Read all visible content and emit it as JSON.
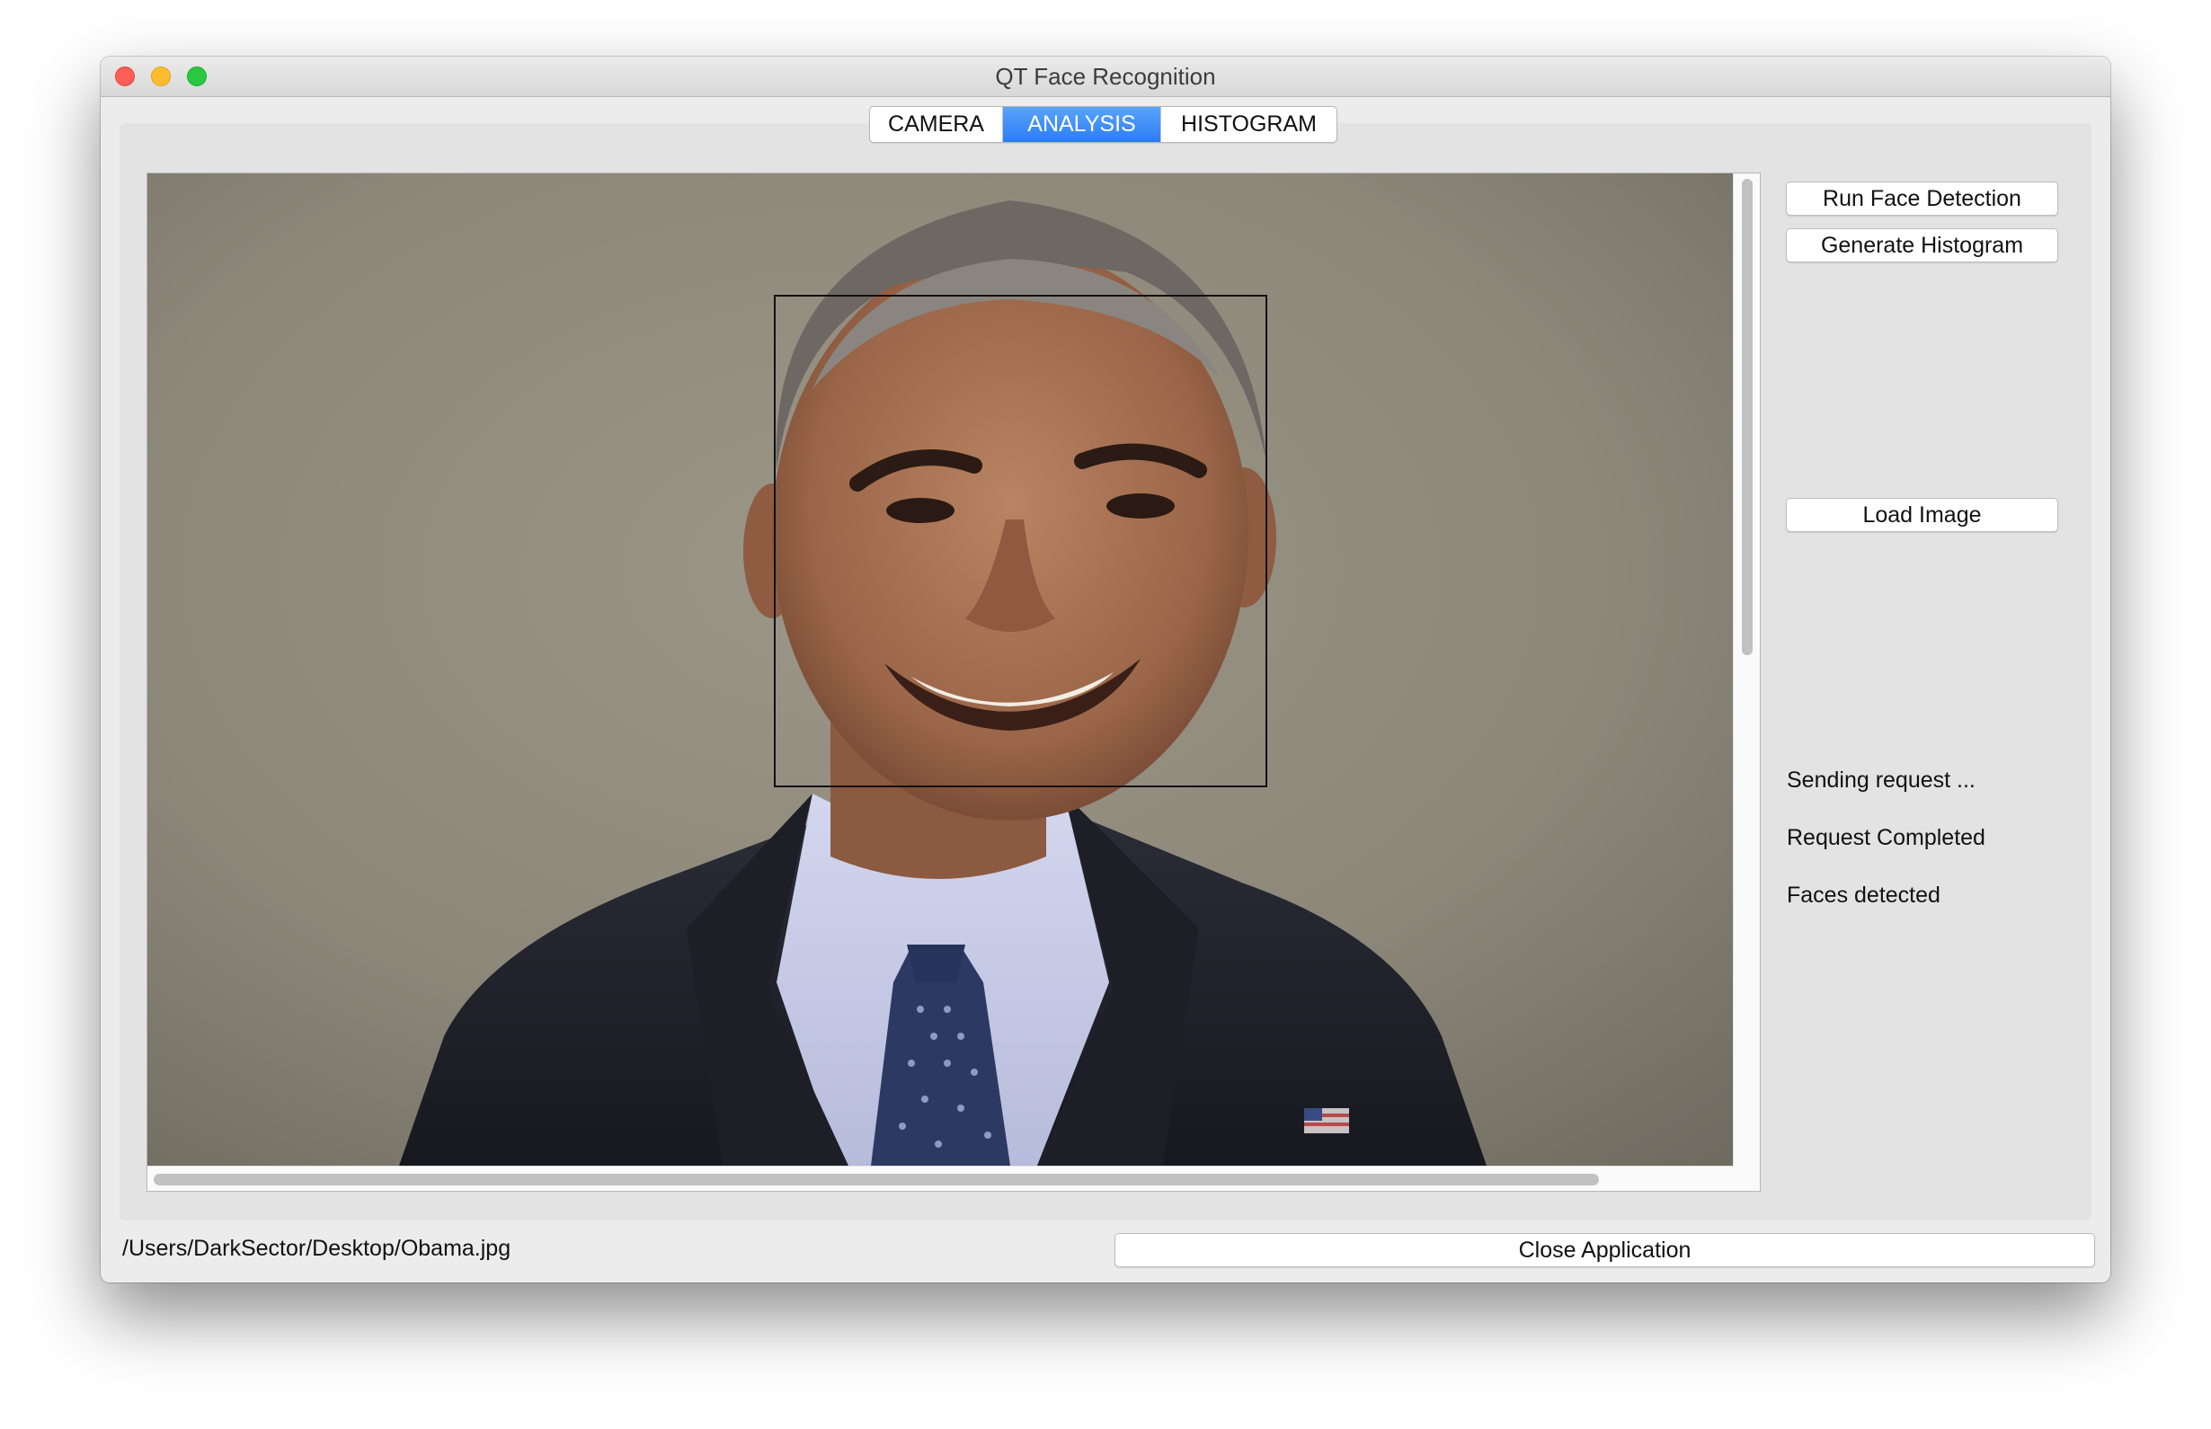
{
  "window": {
    "title": "QT Face Recognition"
  },
  "tabs": [
    {
      "label": "CAMERA",
      "active": false
    },
    {
      "label": "ANALYSIS",
      "active": true
    },
    {
      "label": "HISTOGRAM",
      "active": false
    }
  ],
  "buttons": {
    "run_face_detection": "Run Face Detection",
    "generate_histogram": "Generate Histogram",
    "load_image": "Load Image",
    "close_application": "Close Application"
  },
  "status": {
    "sending": "Sending request ...",
    "completed": "Request Completed",
    "faces": "Faces detected"
  },
  "file_path": "/Users/DarkSector/Desktop/Obama.jpg",
  "colors": {
    "active_tab": "#2a7df5",
    "face_box": "#111111",
    "close_light": "#fc5f57",
    "minimize_light": "#fdbc2e",
    "maximize_light": "#28c840"
  }
}
